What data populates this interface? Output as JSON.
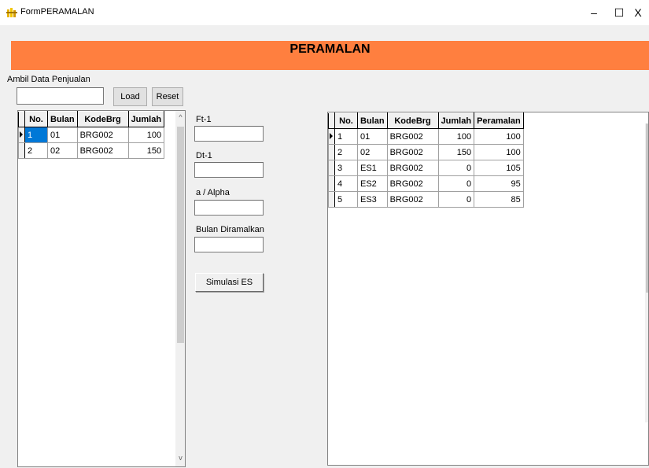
{
  "window": {
    "title": "FormPERAMALAN",
    "minimize_symbol": "–",
    "maximize_symbol": "☐",
    "close_symbol": "X"
  },
  "banner": {
    "text": "PERAMALAN",
    "color": "#ff7f3f"
  },
  "left_panel": {
    "ambil_label": "Ambil Data Penjualan",
    "ambil_value": "",
    "load_label": "Load",
    "reset_label": "Reset"
  },
  "grid_left": {
    "headers": [
      "No.",
      "Bulan",
      "KodeBrg",
      "Jumlah"
    ],
    "rows": [
      [
        "1",
        "01",
        "BRG002",
        "100"
      ],
      [
        "2",
        "02",
        "BRG002",
        "150"
      ]
    ],
    "scroll_up": "^",
    "scroll_down": "v"
  },
  "middle_panel": {
    "ft1_label": "Ft-1",
    "ft1_value": "",
    "dt1_label": "Dt-1",
    "dt1_value": "",
    "alpha_label": "a / Alpha",
    "alpha_value": "",
    "bulan_label": "Bulan Diramalkan",
    "bulan_value": "",
    "simulasi_label": "Simulasi ES"
  },
  "grid_right": {
    "headers": [
      "No.",
      "Bulan",
      "KodeBrg",
      "Jumlah",
      "Peramalan"
    ],
    "rows": [
      [
        "1",
        "01",
        "BRG002",
        "100",
        "100"
      ],
      [
        "2",
        "02",
        "BRG002",
        "150",
        "100"
      ],
      [
        "3",
        "ES1",
        "BRG002",
        "0",
        "105"
      ],
      [
        "4",
        "ES2",
        "BRG002",
        "0",
        "95"
      ],
      [
        "5",
        "ES3",
        "BRG002",
        "0",
        "85"
      ]
    ]
  }
}
